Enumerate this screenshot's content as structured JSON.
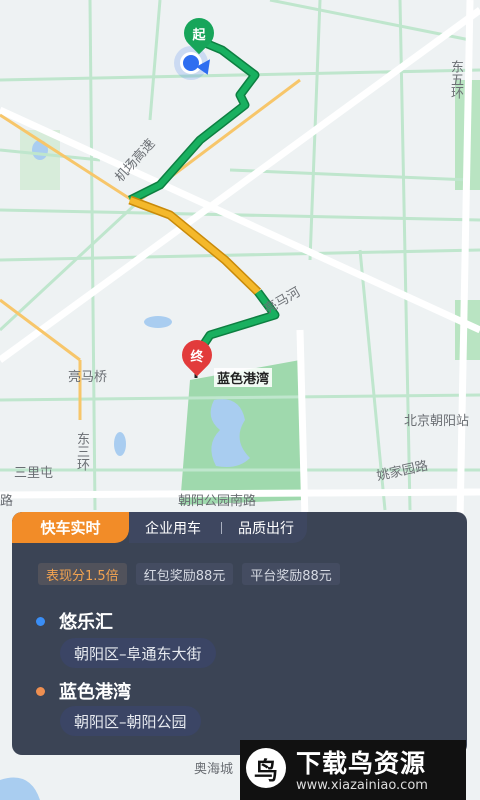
{
  "map": {
    "start_marker": "起",
    "end_marker": "终",
    "destination_label": "蓝色港湾",
    "road_labels": [
      "机场高速",
      "亮马河",
      "亮马桥",
      "东三环",
      "东五环",
      "三里屯",
      "朝阳公园南路",
      "北京朝阳站",
      "姚家园路",
      "奥海城",
      "路"
    ],
    "colors": {
      "route_green": "#18a85a",
      "route_yellow": "#f2b21a",
      "panel": "#30384a",
      "accent": "#f28c28"
    }
  },
  "panel": {
    "tabs": [
      {
        "label": "快车实时",
        "active": true
      },
      {
        "label": "企业用车",
        "active": false
      },
      {
        "label": "品质出行",
        "active": false
      }
    ],
    "badges": [
      {
        "text": "表现分1.5倍",
        "highlight": true
      },
      {
        "text": "红包奖励88元",
        "highlight": false
      },
      {
        "text": "平台奖励88元",
        "highlight": false
      }
    ],
    "pickup": {
      "name": "悠乐汇",
      "address": "朝阳区–阜通东大街",
      "dot_color": "#3a8ef6"
    },
    "dropoff": {
      "name": "蓝色港湾",
      "address": "朝阳区–朝阳公园",
      "dot_color": "#ee8f51"
    }
  },
  "watermark": {
    "title": "下载鸟资源",
    "url": "www.xiazainiao.com",
    "logo_icon": "bird-logo-icon"
  }
}
